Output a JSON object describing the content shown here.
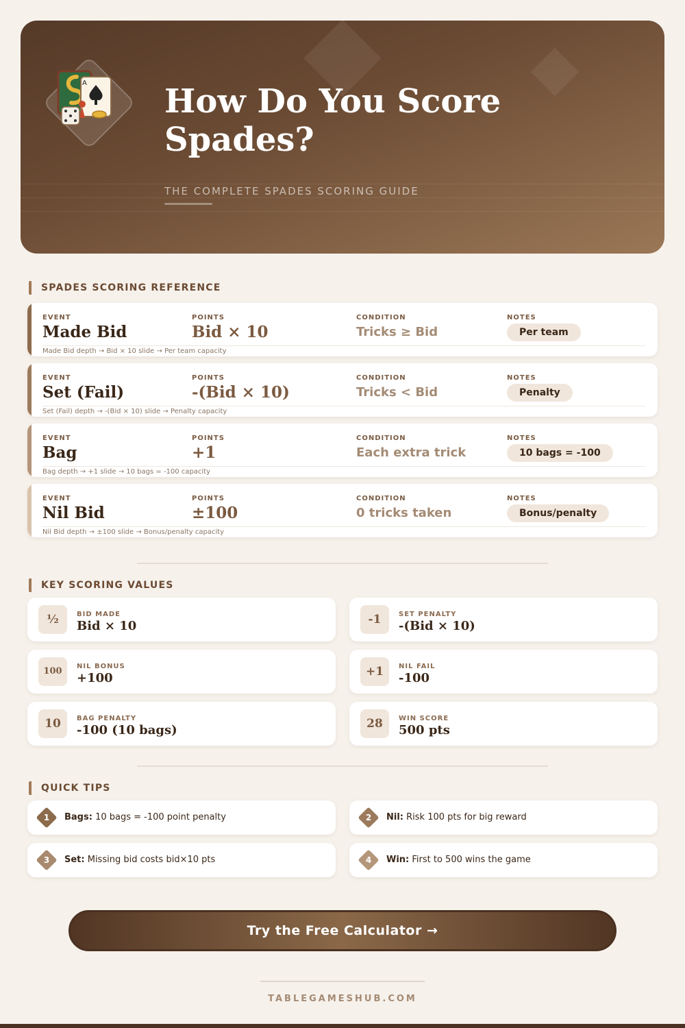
{
  "hero": {
    "title": "How Do You Score Spades?",
    "subtitle": "THE COMPLETE SPADES SCORING GUIDE",
    "logo_icon": "board-game-icon"
  },
  "reference": {
    "heading": "SPADES SCORING REFERENCE",
    "col_labels": {
      "event": "EVENT",
      "points": "POINTS",
      "condition": "CONDITION",
      "notes": "NOTES"
    },
    "rows": [
      {
        "event": "Made Bid",
        "points": "Bid × 10",
        "condition": "Tricks ≥ Bid",
        "note": "Per team",
        "footer": "Made Bid depth → Bid × 10 slide → Per team capacity",
        "accent": "#8c6a4c"
      },
      {
        "event": "Set (Fail)",
        "points": "-(Bid × 10)",
        "condition": "Tricks < Bid",
        "note": "Penalty",
        "footer": "Set (Fail) depth → -(Bid × 10) slide → Penalty capacity",
        "accent": "#9c7b5d"
      },
      {
        "event": "Bag",
        "points": "+1",
        "condition": "Each extra trick",
        "note": "10 bags = -100",
        "footer": "Bag depth → +1 slide → 10 bags = -100 capacity",
        "accent": "#b4967a"
      },
      {
        "event": "Nil Bid",
        "points": "±100",
        "condition": "0 tricks taken",
        "note": "Bonus/penalty",
        "footer": "Nil Bid depth → ±100 slide → Bonus/penalty capacity",
        "accent": "#d8c3ac"
      }
    ]
  },
  "key_values": {
    "heading": "KEY SCORING VALUES",
    "items": [
      {
        "badge": "½",
        "label": "BID MADE",
        "value": "Bid × 10"
      },
      {
        "badge": "-1",
        "label": "SET PENALTY",
        "value": "-(Bid × 10)"
      },
      {
        "badge": "100",
        "label": "NIL BONUS",
        "value": "+100"
      },
      {
        "badge": "+1",
        "label": "NIL FAIL",
        "value": "-100"
      },
      {
        "badge": "10",
        "label": "BAG PENALTY",
        "value": "-100 (10 bags)"
      },
      {
        "badge": "28",
        "label": "WIN SCORE",
        "value": "500 pts"
      }
    ]
  },
  "tips": {
    "heading": "QUICK TIPS",
    "items": [
      {
        "num": "1",
        "title": "Bags:",
        "text": " 10 bags = -100 point penalty",
        "color": "#8c6a4c"
      },
      {
        "num": "2",
        "title": "Nil:",
        "text": " Risk 100 pts for big reward",
        "color": "#9c7b5d"
      },
      {
        "num": "3",
        "title": "Set:",
        "text": " Missing bid costs bid×10 pts",
        "color": "#a88a6e"
      },
      {
        "num": "4",
        "title": "Win:",
        "text": " First to 500 wins the game",
        "color": "#b4967a"
      }
    ]
  },
  "cta": {
    "label": "Try the Free Calculator →"
  },
  "footer": {
    "site": "TABLEGAMESHUB.COM"
  }
}
